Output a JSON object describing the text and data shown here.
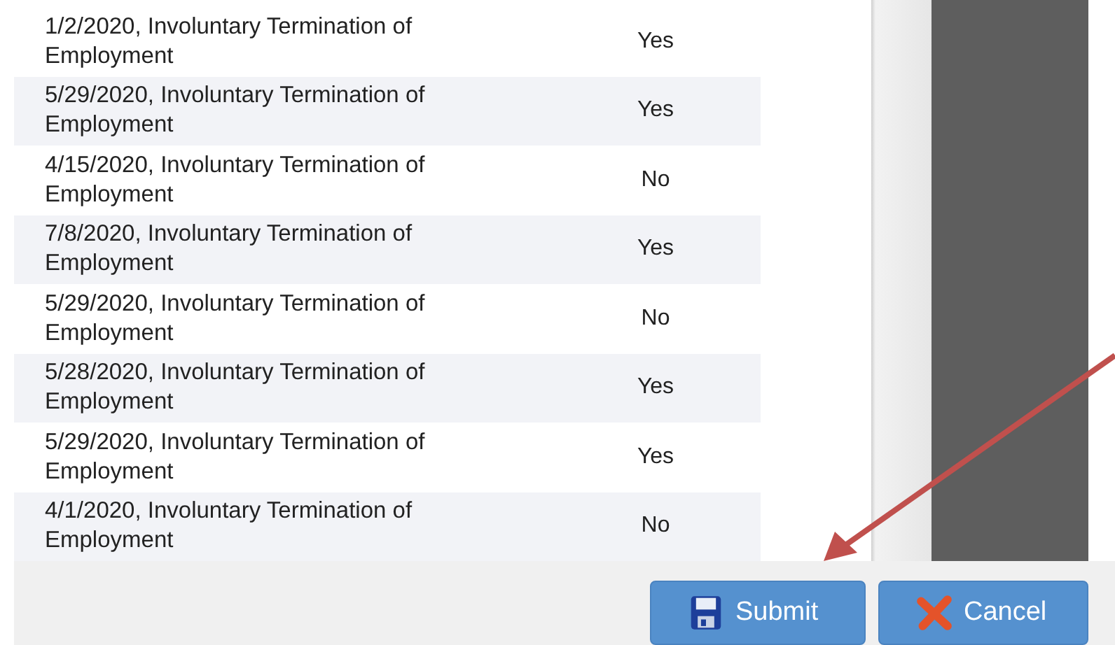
{
  "rows": [
    {
      "description": "1/2/2020, Involuntary Termination of Employment",
      "answer": "Yes"
    },
    {
      "description": "5/29/2020, Involuntary Termination of Employment",
      "answer": "Yes"
    },
    {
      "description": "4/15/2020, Involuntary Termination of Employment",
      "answer": "No"
    },
    {
      "description": "7/8/2020, Involuntary Termination of Employment",
      "answer": "Yes"
    },
    {
      "description": "5/29/2020, Involuntary Termination of Employment",
      "answer": "No"
    },
    {
      "description": "5/28/2020, Involuntary Termination of Employment",
      "answer": "Yes"
    },
    {
      "description": "5/29/2020, Involuntary Termination of Employment",
      "answer": "Yes"
    },
    {
      "description": "4/1/2020, Involuntary Termination of Employment",
      "answer": "No"
    }
  ],
  "buttons": [
    {
      "label": "Submit",
      "kind": "save"
    },
    {
      "label": "Cancel",
      "kind": "cancel"
    }
  ]
}
